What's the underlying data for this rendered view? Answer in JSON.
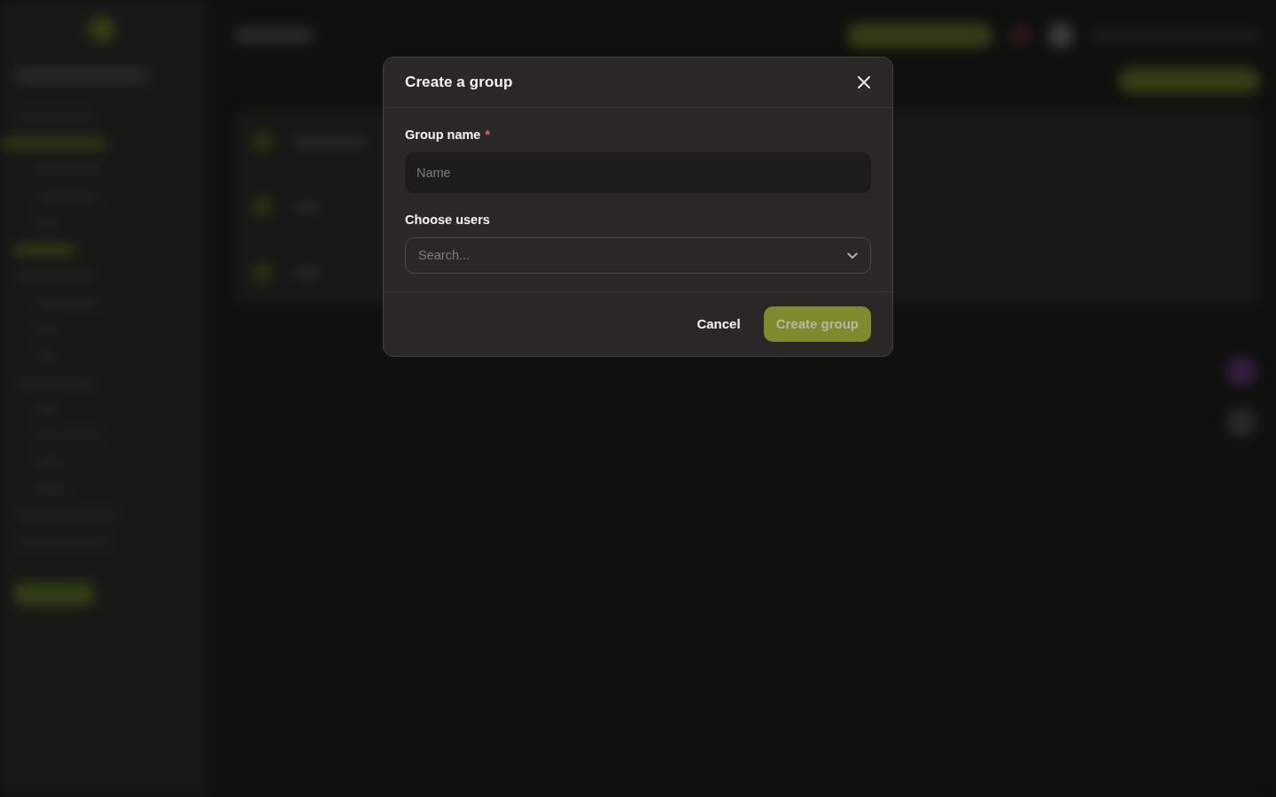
{
  "dialog": {
    "title": "Create a group",
    "fields": [
      {
        "kind": "text",
        "label": "Group name",
        "required_mark": "*",
        "placeholder": "Name"
      },
      {
        "kind": "select",
        "label": "Choose users",
        "placeholder": "Search..."
      }
    ],
    "buttons": [
      {
        "kind": "secondary",
        "label": "Cancel",
        "disabled": false
      },
      {
        "kind": "primary",
        "label": "Create group",
        "disabled": true
      }
    ]
  }
}
